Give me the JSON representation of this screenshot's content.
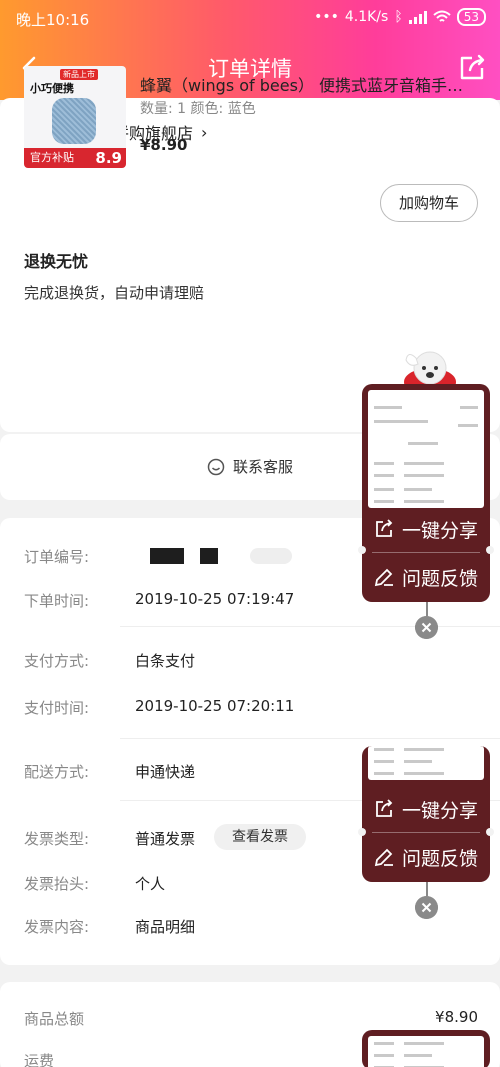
{
  "statusbar": {
    "time": "晚上10:16",
    "network": "4.1K/s",
    "battery": "53"
  },
  "nav": {
    "title": "订单详情"
  },
  "store": {
    "name": "蜂翼数码拼购旗舰店",
    "chevron": "›"
  },
  "product": {
    "title": "蜂翼（wings of bees） 便携式蓝牙音箱手…",
    "spec": "数量: 1  颜色: 蓝色",
    "price": "¥8.90",
    "image_tag_new": "新品上市",
    "image_tag_main": "小巧便携",
    "image_banner": "官方补贴",
    "image_price": "8.9"
  },
  "cart_button": "加购物车",
  "return_service": {
    "title": "退换无忧",
    "desc": "完成退换货，自动申请理赔"
  },
  "customer_service": "联系客服",
  "order_info": {
    "order_number_label": "订单编号:",
    "order_time_label": "下单时间:",
    "order_time": "2019-10-25 07:19:47",
    "pay_method_label": "支付方式:",
    "pay_method": "白条支付",
    "pay_time_label": "支付时间:",
    "pay_time": "2019-10-25 07:20:11",
    "delivery_label": "配送方式:",
    "delivery": "申通快递",
    "invoice_type_label": "发票类型:",
    "invoice_type": "普通发票",
    "view_invoice": "查看发票",
    "invoice_title_label": "发票抬头:",
    "invoice_title": "个人",
    "invoice_content_label": "发票内容:",
    "invoice_content": "商品明细"
  },
  "summary": {
    "total_label": "商品总额",
    "total_amount": "¥8.90",
    "shipping_label": "运费"
  },
  "float_panel": {
    "share": "一键分享",
    "feedback": "问题反馈"
  },
  "colors": {
    "header_start": "#ff9a2e",
    "header_end": "#ff4fc2",
    "float_bg": "#5f1e22"
  },
  "icons": [
    "back-arrow-icon",
    "share-icon",
    "store-icon",
    "customer-service-icon",
    "close-icon",
    "edit-icon"
  ]
}
